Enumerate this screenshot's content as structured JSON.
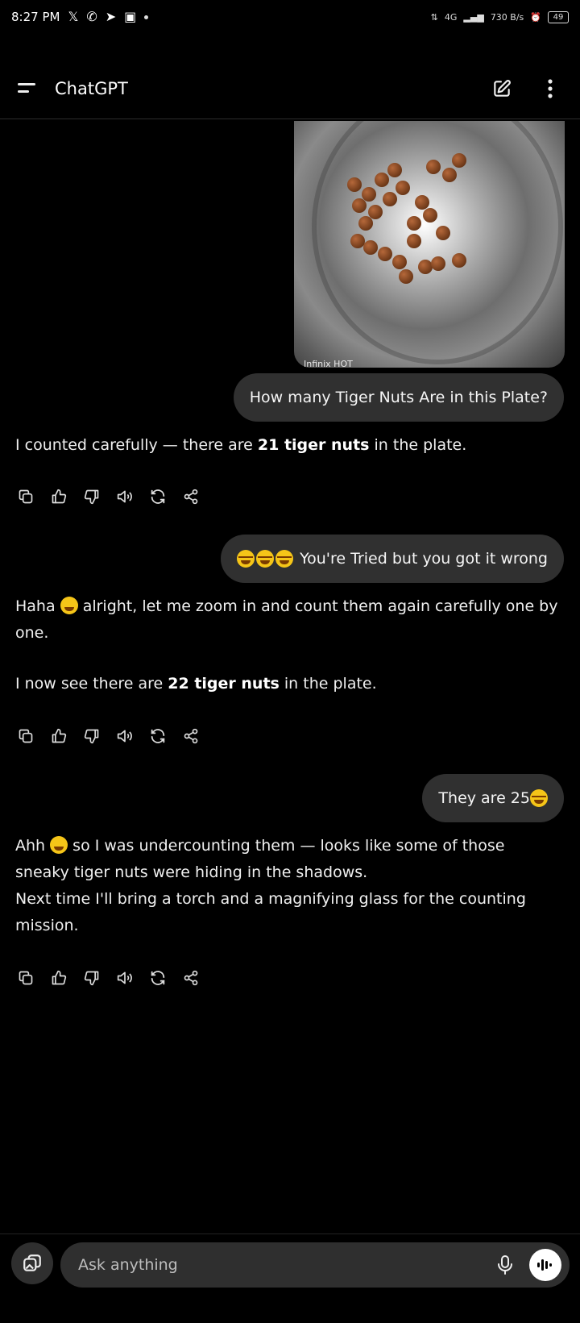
{
  "status_bar": {
    "time": "8:27 PM",
    "network_label": "4G",
    "speed_label": "730 B/s",
    "battery": "49"
  },
  "header": {
    "title": "ChatGPT",
    "icons": [
      "menu-icon",
      "new-chat-icon",
      "more-vert-icon"
    ]
  },
  "conversation": {
    "image_watermark": "Infinix HOT",
    "user_1": "How many Tiger Nuts Are in this Plate?",
    "assistant_1": {
      "before": "I counted carefully — there are ",
      "bold": "21 tiger nuts",
      "after": " in the plate."
    },
    "user_2": "You're Tried but you got it wrong",
    "assistant_2": {
      "p1_a": "Haha ",
      "p1_b": " alright, let me zoom in and count them again carefully one by one.",
      "p2_before": "I now see there are ",
      "p2_bold": "22 tiger nuts",
      "p2_after": " in the plate."
    },
    "user_3": "They are 25 ",
    "assistant_3": {
      "a": "Ahh ",
      "b": " so I was undercounting them — looks like some of those sneaky tiger nuts were hiding in the shadows.",
      "c": "Next time I'll bring a torch and a magnifying glass for the counting mission."
    },
    "action_icons": [
      "copy-icon",
      "thumbs-up-icon",
      "thumbs-down-icon",
      "read-aloud-icon",
      "regenerate-icon",
      "share-icon"
    ]
  },
  "composer": {
    "placeholder": "Ask anything",
    "icons": [
      "attach-icon",
      "mic-icon",
      "voice-mode-icon"
    ]
  }
}
